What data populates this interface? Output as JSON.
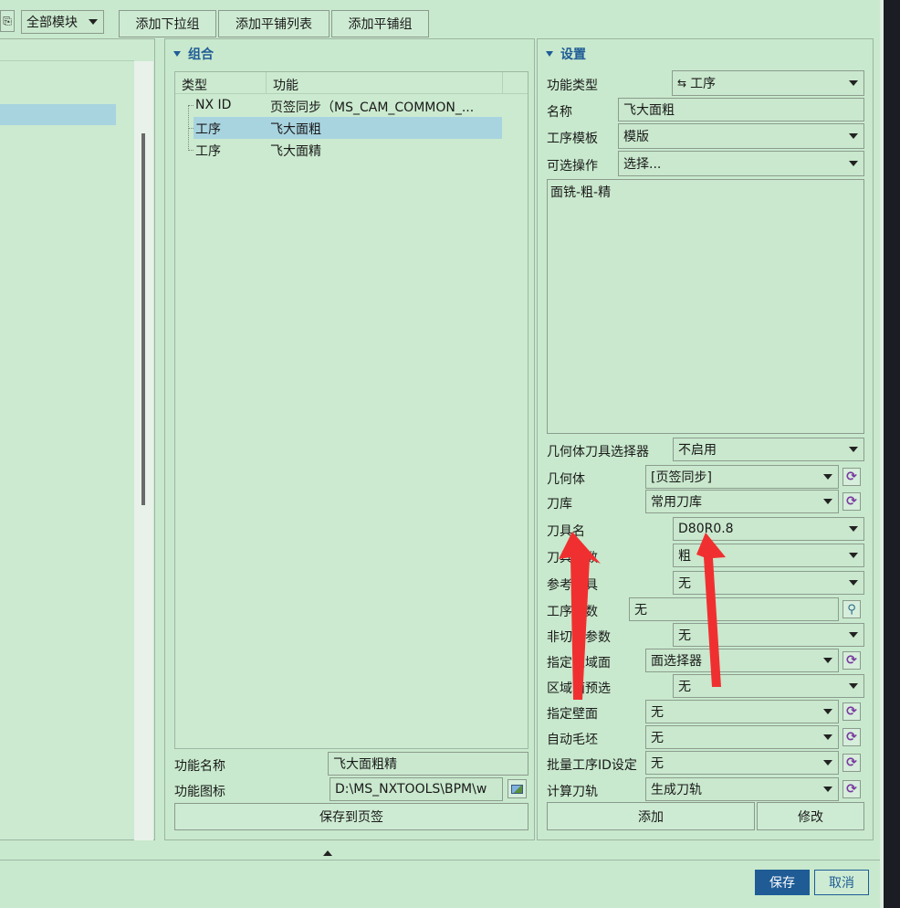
{
  "toolbar": {
    "module_select": "全部模块",
    "tab_buttons": [
      "添加下拉组",
      "添加平铺列表",
      "添加平铺组"
    ]
  },
  "group_panel": {
    "title": "组合",
    "columns": [
      "类型",
      "功能"
    ],
    "rows": [
      {
        "type": "NX ID",
        "func": "页签同步（MS_CAM_COMMON_..."
      },
      {
        "type": "工序",
        "func": "飞大面粗"
      },
      {
        "type": "工序",
        "func": "飞大面精"
      }
    ],
    "func_name_label": "功能名称",
    "func_name_value": "飞大面粗精",
    "func_icon_label": "功能图标",
    "func_icon_value": "D:\\MS_NXTOOLS\\BPM\\w",
    "save_tab_button": "保存到页签"
  },
  "settings_panel": {
    "title": "设置",
    "func_type_label": "功能类型",
    "func_type_value": "工序",
    "name_label": "名称",
    "name_value": "飞大面粗",
    "op_template_label": "工序模板",
    "op_template_value": "模版",
    "optional_op_label": "可选操作",
    "optional_op_value": "选择...",
    "description_text": "面铣-粗-精",
    "rows": [
      {
        "label": "几何体刀具选择器",
        "value": "不启用",
        "refresh": false
      },
      {
        "label": "几何体",
        "value": "[页签同步]",
        "refresh": true
      },
      {
        "label": "刀库",
        "value": "常用刀库",
        "refresh": true
      },
      {
        "label": "刀具名",
        "value": "D80R0.8",
        "refresh": false
      },
      {
        "label": "刀具参数",
        "value": "粗",
        "refresh": false
      },
      {
        "label": "参考刀具",
        "value": "无",
        "refresh": false
      },
      {
        "label": "工序参数",
        "value": "无",
        "refresh": false
      },
      {
        "label": "非切削参数",
        "value": "无",
        "refresh": false
      },
      {
        "label": "指定区域面",
        "value": "面选择器",
        "refresh": true
      },
      {
        "label": "区域面预选",
        "value": "无",
        "refresh": false
      },
      {
        "label": "指定壁面",
        "value": "无",
        "refresh": true
      },
      {
        "label": "自动毛坯",
        "value": "无",
        "refresh": true
      },
      {
        "label": "批量工序ID设定",
        "value": "无",
        "refresh": true
      },
      {
        "label": "计算刀轨",
        "value": "生成刀轨",
        "refresh": true
      }
    ],
    "add_button": "添加",
    "modify_button": "修改"
  },
  "footer": {
    "save_button": "保存",
    "cancel_button": "取消"
  },
  "colors": {
    "background": "#c8e9cd",
    "selected_row": "#a8d4e0",
    "header_blue": "#1f5c96",
    "save_button": "#1f5c96",
    "arrow_red": "#f03030"
  }
}
